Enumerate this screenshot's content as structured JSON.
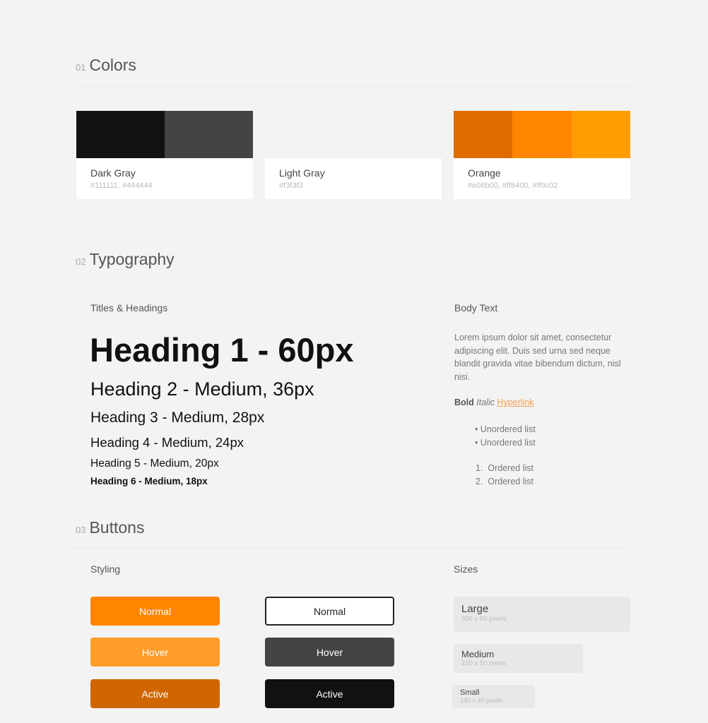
{
  "sections": [
    {
      "num": "01",
      "title": "Colors"
    },
    {
      "num": "02",
      "title": "Typography"
    },
    {
      "num": "03",
      "title": "Buttons"
    }
  ],
  "colors": [
    {
      "name": "Dark Gray",
      "hex": "#111111, #444444",
      "swatches": [
        "#111111",
        "#444444"
      ]
    },
    {
      "name": "Light Gray",
      "hex": "#f3f3f3",
      "swatches": [
        "#f3f3f3"
      ]
    },
    {
      "name": "Orange",
      "hex": "#e06b00, #ff8400, #ff9c02",
      "swatches": [
        "#e06b00",
        "#ff8400",
        "#ff9c02"
      ]
    }
  ],
  "typography": {
    "titles_label": "Titles & Headings",
    "headings": [
      "Heading 1 - 60px",
      "Heading 2 - Medium, 36px",
      "Heading 3 - Medium, 28px",
      "Heading 4 - Medium, 24px",
      "Heading 5 - Medium, 20px",
      "Heading 6 - Medium, 18px"
    ],
    "body_label": "Body Text",
    "paragraph": "Lorem ipsum dolor sit amet, consectetur adipiscing elit. Duis sed urna sed neque blandit gravida vitae bibendum dictum, nisl nisi.",
    "bold": "Bold",
    "italic": "Italic",
    "link": "Hyperlink",
    "unordered": [
      "Unordered list",
      "Unordered list"
    ],
    "ordered": [
      "Ordered list",
      "Ordered list"
    ]
  },
  "buttons": {
    "styling_label": "Styling",
    "sizes_label": "Sizes",
    "primary": [
      "Normal",
      "Hover",
      "Active"
    ],
    "secondary": [
      "Normal",
      "Hover",
      "Active"
    ],
    "sizes": [
      {
        "name": "Large",
        "dims": "300 x 60 pixels"
      },
      {
        "name": "Medium",
        "dims": "220 x 50 pixels"
      },
      {
        "name": "Small",
        "dims": "140 x 40 pixels"
      }
    ]
  }
}
